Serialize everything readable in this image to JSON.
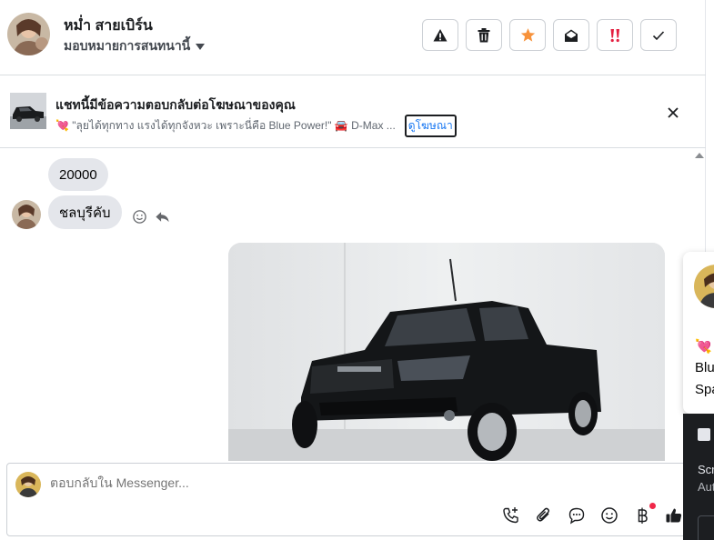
{
  "header": {
    "contact_name": "หม่ำ สายเบิร์น",
    "assign_label": "มอบหมายการสนทนานี้",
    "toolbar": [
      {
        "name": "report-spam-button",
        "icon": "warning-icon"
      },
      {
        "name": "delete-button",
        "icon": "trash-icon"
      },
      {
        "name": "star-button",
        "icon": "star-icon",
        "color": "#f7923b"
      },
      {
        "name": "mark-unread-button",
        "icon": "envelope-open-icon"
      },
      {
        "name": "mark-priority-button",
        "icon": "exclamation-icon",
        "color": "#e41e3f"
      },
      {
        "name": "mark-done-button",
        "icon": "check-icon"
      }
    ]
  },
  "banner": {
    "title": "แชทนี้มีข้อความตอบกลับต่อโฆษณาของคุณ",
    "subtitle": "💘 \"ลุยได้ทุกทาง แรงได้ทุกจังหวะ เพราะนี่คือ Blue Power!\" 🚘 D-Max ...",
    "view_ad_label": "ดูโฆษณา"
  },
  "messages": [
    {
      "text": "20000"
    },
    {
      "text": "ชลบุรีคับ"
    }
  ],
  "composer": {
    "placeholder": "ตอบกลับใน Messenger..."
  },
  "side_panel": {
    "line1": "💘",
    "line2": "Blu",
    "line3": "Spa",
    "line4": "Scr",
    "line5": "Aut"
  },
  "colors": {
    "accent": "#1877f2",
    "star": "#f7923b",
    "priority": "#e41e3f",
    "bubble": "#e4e6eb",
    "notification": "#f02849"
  }
}
